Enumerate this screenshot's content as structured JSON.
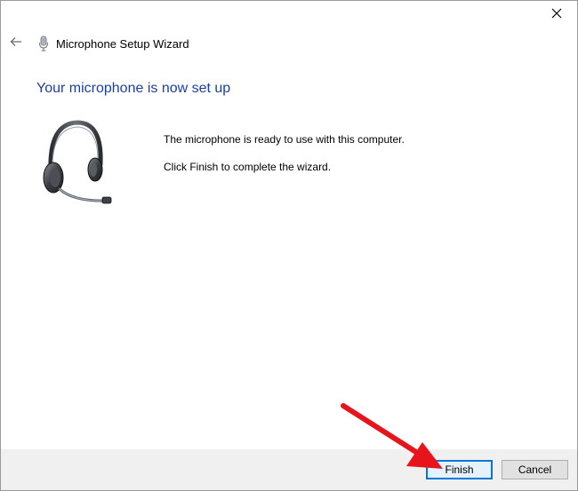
{
  "window": {
    "close_glyph": "✕"
  },
  "header": {
    "back_icon": "back-arrow-icon",
    "app_icon": "microphone-icon",
    "title": "Microphone Setup Wizard"
  },
  "main": {
    "heading": "Your microphone is now set up",
    "illustration": "headset-icon",
    "message_line1": "The microphone is ready to use with this computer.",
    "message_line2": "Click Finish to complete the wizard."
  },
  "footer": {
    "finish_label": "Finish",
    "cancel_label": "Cancel"
  },
  "annotation": {
    "arrow_color": "#e8141c",
    "target": "Finish"
  },
  "colors": {
    "heading": "#1a3fa8",
    "footer_bg": "#f0f0f0",
    "focus_border": "#0078d7"
  }
}
